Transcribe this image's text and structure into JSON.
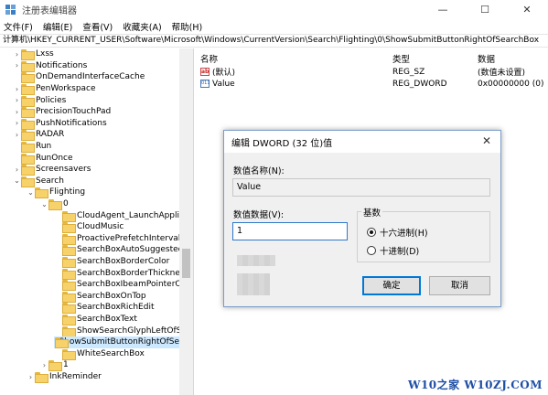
{
  "window": {
    "title": "注册表编辑器",
    "controls": {
      "minimize": "—",
      "maximize": "☐",
      "close": "✕"
    }
  },
  "menu": [
    "文件(F)",
    "编辑(E)",
    "查看(V)",
    "收藏夹(A)",
    "帮助(H)"
  ],
  "address": "计算机\\HKEY_CURRENT_USER\\Software\\Microsoft\\Windows\\CurrentVersion\\Search\\Flighting\\0\\ShowSubmitButtonRightOfSearchBox",
  "tree": {
    "items": [
      {
        "label": "Lxss",
        "caret": "›",
        "level": 0
      },
      {
        "label": "Notifications",
        "caret": "›",
        "level": 0
      },
      {
        "label": "OnDemandInterfaceCache",
        "caret": "",
        "level": 0
      },
      {
        "label": "PenWorkspace",
        "caret": "›",
        "level": 0
      },
      {
        "label": "Policies",
        "caret": "›",
        "level": 0
      },
      {
        "label": "PrecisionTouchPad",
        "caret": "›",
        "level": 0
      },
      {
        "label": "PushNotifications",
        "caret": "›",
        "level": 0
      },
      {
        "label": "RADAR",
        "caret": "›",
        "level": 0
      },
      {
        "label": "Run",
        "caret": "",
        "level": 0
      },
      {
        "label": "RunOnce",
        "caret": "",
        "level": 0
      },
      {
        "label": "Screensavers",
        "caret": "›",
        "level": 0
      },
      {
        "label": "Search",
        "caret": "⌄",
        "level": 0
      },
      {
        "label": "Flighting",
        "caret": "⌄",
        "level": 1
      },
      {
        "label": "0",
        "caret": "⌄",
        "level": 2
      },
      {
        "label": "CloudAgent_LaunchApplicati",
        "caret": "",
        "level": 3
      },
      {
        "label": "CloudMusic",
        "caret": "",
        "level": 3
      },
      {
        "label": "ProactivePrefetchIntervalMin",
        "caret": "",
        "level": 3
      },
      {
        "label": "SearchBoxAutoSuggestedFo",
        "caret": "",
        "level": 3
      },
      {
        "label": "SearchBoxBorderColor",
        "caret": "",
        "level": 3
      },
      {
        "label": "SearchBoxBorderThickness",
        "caret": "",
        "level": 3
      },
      {
        "label": "SearchBoxIbeamPointerOnH",
        "caret": "",
        "level": 3
      },
      {
        "label": "SearchBoxOnTop",
        "caret": "",
        "level": 3
      },
      {
        "label": "SearchBoxRichEdit",
        "caret": "",
        "level": 3
      },
      {
        "label": "SearchBoxText",
        "caret": "",
        "level": 3
      },
      {
        "label": "ShowSearchGlyphLeftOfSear",
        "caret": "",
        "level": 3
      },
      {
        "label": "ShowSubmitButtonRightOfSe",
        "caret": "",
        "level": 3,
        "selected": true
      },
      {
        "label": "WhiteSearchBox",
        "caret": "",
        "level": 3
      },
      {
        "label": "1",
        "caret": "›",
        "level": 2
      },
      {
        "label": "InkReminder",
        "caret": "›",
        "level": 1
      }
    ]
  },
  "values": {
    "headers": {
      "name": "名称",
      "type": "类型",
      "data": "数据"
    },
    "rows": [
      {
        "icon": "ab",
        "name": "(默认)",
        "type": "REG_SZ",
        "data": "(数值未设置)"
      },
      {
        "icon": "bin",
        "name": "Value",
        "type": "REG_DWORD",
        "data": "0x00000000 (0)"
      }
    ]
  },
  "dialog": {
    "title": "编辑 DWORD (32 位)值",
    "close": "✕",
    "name_label": "数值名称(N):",
    "name_value": "Value",
    "data_label": "数值数据(V):",
    "data_value": "1",
    "base_label": "基数",
    "hex_label": "十六进制(H)",
    "dec_label": "十进制(D)",
    "selected_base": "hex",
    "ok": "确定",
    "cancel": "取消"
  },
  "watermark": "W10之家 W10ZJ.COM",
  "colors": {
    "selection": "#cce8ff",
    "accent": "#0078d7",
    "watermark": "#1f4fa5"
  }
}
